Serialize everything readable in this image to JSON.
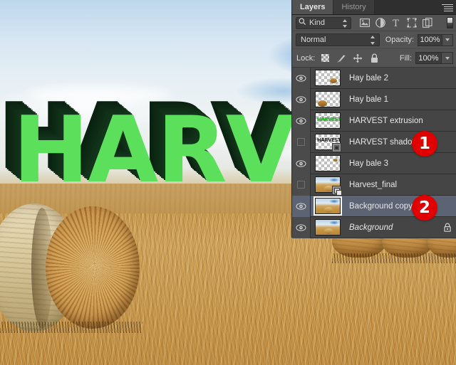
{
  "document": {
    "artwork_text": "HARV",
    "colors": {
      "text_face": "#5ce05c",
      "text_extrusion": "#0e2b15",
      "panel_bg": "#535353",
      "layer_row_bg": "#454545",
      "selected_row_bg": "#5c6474",
      "callout_red": "#e00000"
    }
  },
  "panel": {
    "tabs": [
      {
        "label": "Layers",
        "active": true
      },
      {
        "label": "History",
        "active": false
      }
    ],
    "menu_icon": "panel-menu-icon",
    "filter_row": {
      "kind_label": "Kind",
      "search_icon": "search-icon",
      "stepper_icon": "stepper-updown-icon",
      "icons": [
        {
          "name": "filter-pixel-layers-icon",
          "glyph": "image"
        },
        {
          "name": "filter-adjustment-layers-icon",
          "glyph": "circle"
        },
        {
          "name": "filter-type-layers-icon",
          "glyph": "T"
        },
        {
          "name": "filter-shape-layers-icon",
          "glyph": "shape"
        },
        {
          "name": "filter-smart-object-icon",
          "glyph": "smart"
        }
      ],
      "toggle_name": "filter-enable-toggle"
    },
    "blend_row": {
      "blend_mode": "Normal",
      "opacity_label": "Opacity:",
      "opacity_value": "100%"
    },
    "lock_row": {
      "lock_label": "Lock:",
      "lock_icons": [
        {
          "name": "lock-transparent-pixels-icon"
        },
        {
          "name": "lock-image-pixels-icon"
        },
        {
          "name": "lock-position-icon"
        },
        {
          "name": "lock-all-icon"
        }
      ],
      "fill_label": "Fill:",
      "fill_value": "100%"
    },
    "layers": [
      {
        "name": "Hay bale  2",
        "visible": true,
        "selected": false,
        "italic": false,
        "thumb": "transparent-bale-right",
        "badge": "",
        "locked": false
      },
      {
        "name": "Hay bale  1",
        "visible": true,
        "selected": false,
        "italic": false,
        "thumb": "transparent-bale-left",
        "badge": "",
        "locked": false
      },
      {
        "name": "HARVEST extrusion",
        "visible": true,
        "selected": false,
        "italic": false,
        "thumb": "green-text",
        "badge": "",
        "locked": false,
        "thumb_text": "HARVEST"
      },
      {
        "name": "HARVEST shadow",
        "visible": false,
        "selected": false,
        "italic": false,
        "thumb": "dark-text",
        "badge": "3d",
        "locked": false,
        "thumb_text": "HARVEST"
      },
      {
        "name": "Hay bale  3",
        "visible": true,
        "selected": false,
        "italic": false,
        "thumb": "transparent-bale-tiny",
        "badge": "",
        "locked": false
      },
      {
        "name": "Harvest_final",
        "visible": false,
        "selected": false,
        "italic": false,
        "thumb": "photo",
        "badge": "smart-object",
        "locked": false
      },
      {
        "name": "Background copy",
        "visible": true,
        "selected": true,
        "italic": false,
        "thumb": "photo",
        "badge": "",
        "locked": false
      },
      {
        "name": "Background",
        "visible": true,
        "selected": false,
        "italic": true,
        "thumb": "photo",
        "badge": "",
        "locked": true
      }
    ]
  },
  "callouts": [
    {
      "label": "1",
      "target_layer": "HARVEST shadow"
    },
    {
      "label": "2",
      "target_layer": "Background copy"
    }
  ]
}
